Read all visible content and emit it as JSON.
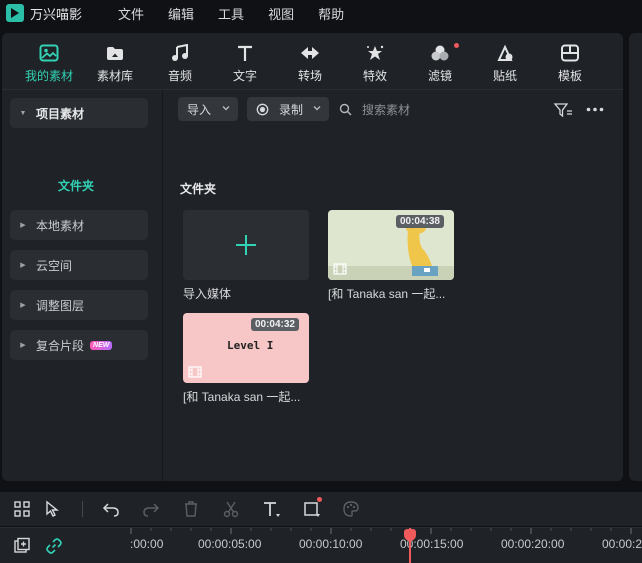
{
  "app": {
    "name": "万兴喵影"
  },
  "menu": [
    "文件",
    "编辑",
    "工具",
    "视图",
    "帮助"
  ],
  "toolbar": {
    "tabs": [
      {
        "label": "我的素材",
        "icon": "my-media-icon",
        "active": true
      },
      {
        "label": "素材库",
        "icon": "stock-media-icon"
      },
      {
        "label": "音频",
        "icon": "music-note-icon"
      },
      {
        "label": "文字",
        "icon": "text-icon"
      },
      {
        "label": "转场",
        "icon": "transition-icon"
      },
      {
        "label": "特效",
        "icon": "effects-icon"
      },
      {
        "label": "滤镜",
        "icon": "filter-icon",
        "dot": true
      },
      {
        "label": "贴纸",
        "icon": "sticker-icon"
      },
      {
        "label": "模板",
        "icon": "template-icon"
      }
    ]
  },
  "sidebar": {
    "items": [
      {
        "label": "项目素材",
        "expanded": true
      },
      {
        "label": "本地素材"
      },
      {
        "label": "云空间"
      },
      {
        "label": "调整图层"
      },
      {
        "label": "复合片段",
        "badge": "NEW"
      }
    ],
    "sub_item": "文件夹"
  },
  "filters": {
    "import_label": "导入",
    "record_label": "录制",
    "search_placeholder": "搜索素材"
  },
  "content": {
    "section_title": "文件夹",
    "cards": [
      {
        "caption": "导入媒体",
        "type": "import"
      },
      {
        "caption": "[和 Tanaka san 一起...",
        "duration": "00:04:38",
        "type": "video"
      },
      {
        "caption": "[和 Tanaka san 一起...",
        "duration": "00:04:32",
        "type": "video",
        "overlay_text": "Level I"
      }
    ]
  },
  "timeline": {
    "labels": [
      ":00:00",
      "00:00:05:00",
      "00:00:10:00",
      "00:00:15:00",
      "00:00:20:00",
      "00:00:2"
    ]
  },
  "colors": {
    "accent": "#32d2b4",
    "playhead": "#f05a5a",
    "background": "#1f2226"
  }
}
